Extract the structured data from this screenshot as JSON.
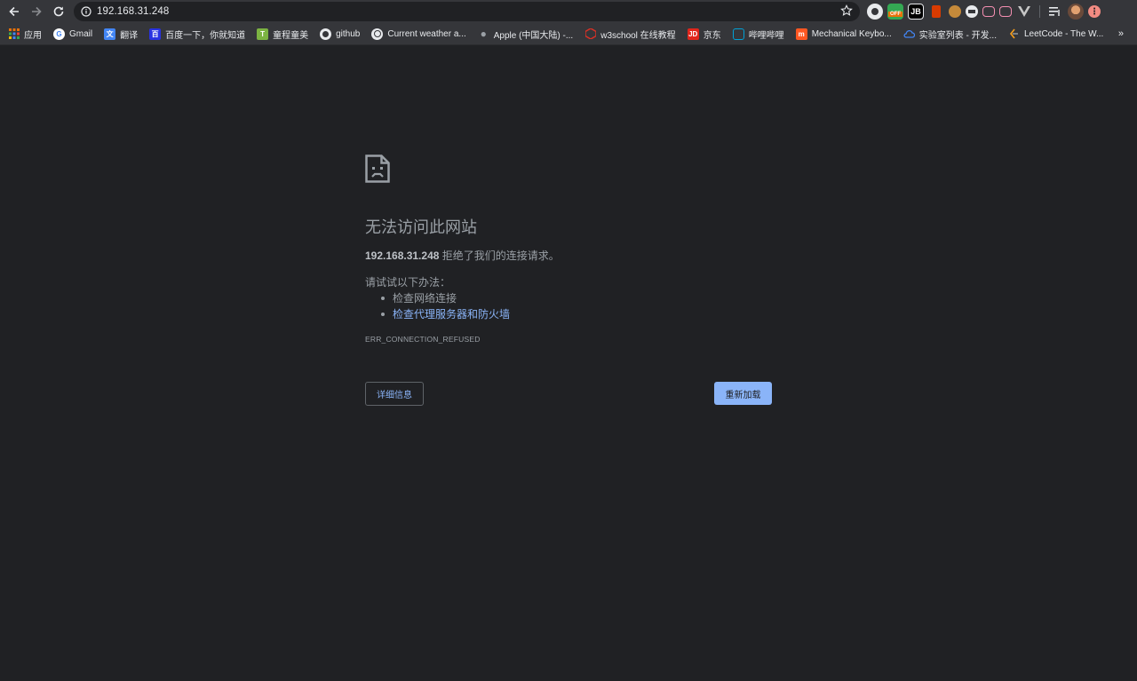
{
  "browser": {
    "url": "192.168.31.248",
    "extensions": [
      {
        "name": "chrome-icon",
        "label": ""
      },
      {
        "name": "off-badge",
        "label": "OFF"
      },
      {
        "name": "jb-icon",
        "label": "JB"
      },
      {
        "name": "office-icon",
        "label": ""
      },
      {
        "name": "cookie-icon",
        "label": ""
      },
      {
        "name": "ext-circle",
        "label": ""
      },
      {
        "name": "bilibili-icon",
        "label": ""
      },
      {
        "name": "tv-icon",
        "label": ""
      },
      {
        "name": "vue-icon",
        "label": ""
      }
    ]
  },
  "bookmarks": [
    {
      "label": "应用",
      "icon": "apps-grid-icon",
      "color": "#e8710a"
    },
    {
      "label": "Gmail",
      "icon": "google-icon",
      "color": "#ffffff"
    },
    {
      "label": "翻译",
      "icon": "translate-icon",
      "color": "#4285f4"
    },
    {
      "label": "百度一下，你就知道",
      "icon": "baidu-icon",
      "color": "#2932e1"
    },
    {
      "label": "童程童美",
      "icon": "tongcheng-icon",
      "color": "#7cb342"
    },
    {
      "label": "github",
      "icon": "github-icon",
      "color": "#ffffff"
    },
    {
      "label": "Current weather a...",
      "icon": "globe-icon",
      "color": "#e8eaed"
    },
    {
      "label": "Apple (中国大陆) -...",
      "icon": "apple-icon",
      "color": "#9aa0a6"
    },
    {
      "label": "w3school 在线教程",
      "icon": "w3school-icon",
      "color": "#d93025"
    },
    {
      "label": "京东",
      "icon": "jd-icon",
      "color": "#e1251b"
    },
    {
      "label": "哔哩哔哩",
      "icon": "bilibili-icon",
      "color": "#00a1d6"
    },
    {
      "label": "Mechanical Keybo...",
      "icon": "keyboard-icon",
      "color": "#ff5722"
    },
    {
      "label": "实验室列表 - 开发...",
      "icon": "cloud-icon",
      "color": "#4285f4"
    },
    {
      "label": "LeetCode - The W...",
      "icon": "leetcode-icon",
      "color": "#f89f1b"
    }
  ],
  "bookmarks_more": "»",
  "error": {
    "title": "无法访问此网站",
    "host": "192.168.31.248",
    "message_suffix": " 拒绝了我们的连接请求。",
    "try_label": "请试试以下办法：",
    "suggestions": [
      {
        "text": "检查网络连接",
        "link": false
      },
      {
        "text": "检查代理服务器和防火墙",
        "link": true
      }
    ],
    "code": "ERR_CONNECTION_REFUSED",
    "details_button": "详细信息",
    "reload_button": "重新加载"
  },
  "colors": {
    "background": "#202124",
    "toolbar": "#35363a",
    "link": "#8ab4f8",
    "text": "#9aa0a6"
  }
}
